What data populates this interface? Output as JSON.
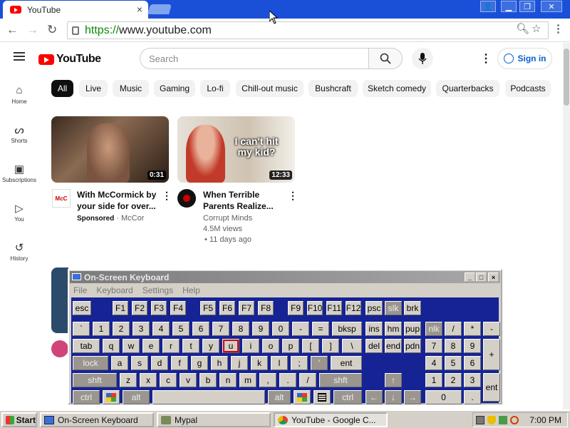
{
  "browser": {
    "tab_title": "YouTube",
    "tab_close": "×",
    "url_scheme": "https://",
    "url_rest": "www.youtube.com",
    "window_min": "▁",
    "window_restore": "❐",
    "window_close": "✕"
  },
  "youtube": {
    "logo_text": "YouTube",
    "search_placeholder": "Search",
    "signin_label": "Sign in",
    "chips": [
      "All",
      "Live",
      "Music",
      "Gaming",
      "Lo-fi",
      "Chill-out music",
      "Bushcraft",
      "Sketch comedy",
      "Quarterbacks",
      "Podcasts"
    ],
    "sidebar": [
      {
        "label": "Home",
        "icon": "home-icon"
      },
      {
        "label": "Shorts",
        "icon": "shorts-icon"
      },
      {
        "label": "Subscriptions",
        "icon": "subscriptions-icon"
      },
      {
        "label": "You",
        "icon": "you-icon"
      },
      {
        "label": "History",
        "icon": "history-icon"
      }
    ],
    "videos": [
      {
        "duration": "0:31",
        "title_line1": "With McCormick by",
        "title_line2": "your side for over...",
        "sponsored": "Sponsored",
        "channel": "McCor",
        "avatar_text": "McC"
      },
      {
        "duration": "12:33",
        "thumb_caption": "I can't hit my kid?",
        "title_line1": "When Terrible",
        "title_line2": "Parents Realize...",
        "channel": "Corrupt Minds",
        "views": "4.5M views",
        "age": "• 11 days ago"
      }
    ]
  },
  "osk": {
    "title": "On-Screen Keyboard",
    "menu": [
      "File",
      "Keyboard",
      "Settings",
      "Help"
    ],
    "keys": {
      "r1": [
        "esc",
        "F1",
        "F2",
        "F3",
        "F4",
        "F5",
        "F6",
        "F7",
        "F8",
        "F9",
        "F10",
        "F11",
        "F12",
        "psc",
        "slk",
        "brk"
      ],
      "r2": [
        "`",
        "1",
        "2",
        "3",
        "4",
        "5",
        "6",
        "7",
        "8",
        "9",
        "0",
        "-",
        "=",
        "bksp",
        "ins",
        "hm",
        "pup",
        "nlk",
        "/",
        "*",
        "-"
      ],
      "r3": [
        "tab",
        "q",
        "w",
        "e",
        "r",
        "t",
        "y",
        "u",
        "i",
        "o",
        "p",
        "[",
        "]",
        "\\",
        "del",
        "end",
        "pdn",
        "7",
        "8",
        "9",
        "+"
      ],
      "r4": [
        "lock",
        "a",
        "s",
        "d",
        "f",
        "g",
        "h",
        "j",
        "k",
        "l",
        ";",
        "'",
        "ent",
        "4",
        "5",
        "6"
      ],
      "r5": [
        "shft",
        "z",
        "x",
        "c",
        "v",
        "b",
        "n",
        "m",
        ",",
        ".",
        "/",
        "shft",
        "↑",
        "1",
        "2",
        "3",
        "ent"
      ],
      "r6": [
        "ctrl",
        "alt",
        "alt",
        "ctrl",
        "←",
        "↓",
        "→",
        "0",
        "."
      ]
    },
    "pressed_key": "u"
  },
  "taskbar": {
    "start": "Start",
    "tasks": [
      "On-Screen Keyboard",
      "Mypal",
      "YouTube - Google C..."
    ],
    "clock": "7:00 PM"
  }
}
